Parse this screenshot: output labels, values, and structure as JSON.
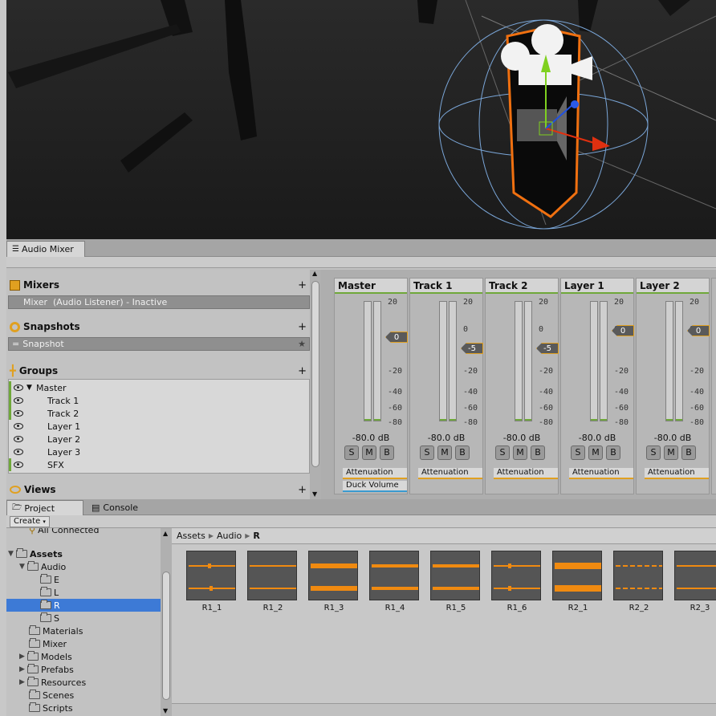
{
  "mixer_tab": {
    "label": "Audio Mixer"
  },
  "mixers": {
    "title": "Mixers",
    "plus": "+",
    "item": "Mixer",
    "item_detail": "(Audio Listener) - Inactive"
  },
  "snapshots": {
    "title": "Snapshots",
    "plus": "+",
    "item": "Snapshot"
  },
  "groups": {
    "title": "Groups",
    "plus": "+",
    "items": [
      {
        "label": "Master"
      },
      {
        "label": "Track 1"
      },
      {
        "label": "Track 2"
      },
      {
        "label": "Layer 1"
      },
      {
        "label": "Layer 2"
      },
      {
        "label": "Layer 3"
      },
      {
        "label": "SFX"
      }
    ]
  },
  "views": {
    "title": "Views",
    "plus": "+"
  },
  "strips": [
    {
      "name": "Master",
      "fader": "0",
      "db": "-80.0 dB",
      "effects": [
        "Attenuation",
        "Duck Volume"
      ]
    },
    {
      "name": "Track 1",
      "fader": "-5",
      "db": "-80.0 dB",
      "effects": [
        "Attenuation"
      ]
    },
    {
      "name": "Track 2",
      "fader": "-5",
      "db": "-80.0 dB",
      "effects": [
        "Attenuation"
      ]
    },
    {
      "name": "Layer 1",
      "fader": "0",
      "db": "-80.0 dB",
      "effects": [
        "Attenuation"
      ]
    },
    {
      "name": "Layer 2",
      "fader": "0",
      "db": "-80.0 dB",
      "effects": [
        "Attenuation"
      ]
    }
  ],
  "meter_ticks": [
    "20",
    "0",
    "-20",
    "-40",
    "-60",
    "-80"
  ],
  "smb": [
    "S",
    "M",
    "B"
  ],
  "project_tabs": {
    "project": "Project",
    "console": "Console"
  },
  "create_label": "Create",
  "tree": {
    "all_connected": "All Connected",
    "assets": "Assets",
    "audio": "Audio",
    "audio_children": [
      "E",
      "L",
      "R",
      "S"
    ],
    "others": [
      "Materials",
      "Mixer",
      "Models",
      "Prefabs",
      "Resources",
      "Scenes",
      "Scripts"
    ]
  },
  "breadcrumb": [
    "Assets",
    "Audio",
    "R"
  ],
  "assets_grid": [
    "R1_1",
    "R1_2",
    "R1_3",
    "R1_4",
    "R1_5",
    "R1_6",
    "R2_1",
    "R2_2",
    "R2_3"
  ],
  "colors": {
    "accent_orange": "#f07010",
    "group_green": "#6fa83a",
    "selection_blue": "#3d7ad6",
    "wave": "#f08a10"
  }
}
